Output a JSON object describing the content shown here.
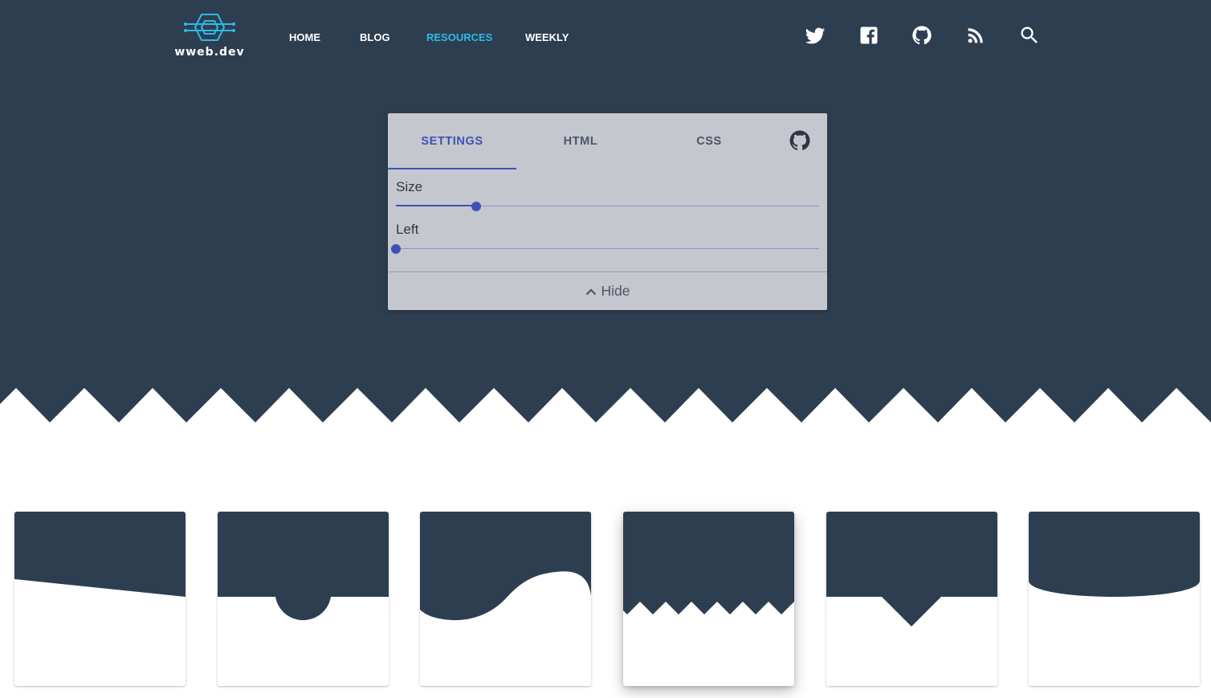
{
  "brand": {
    "name": "wweb.dev",
    "accent": "#2bbbe7",
    "dark": "#2e3e51"
  },
  "nav": [
    {
      "label": "HOME",
      "active": false
    },
    {
      "label": "BLOG",
      "active": false
    },
    {
      "label": "RESOURCES",
      "active": true
    },
    {
      "label": "WEEKLY",
      "active": false
    }
  ],
  "social": [
    "twitter-icon",
    "facebook-icon",
    "github-icon",
    "rss-icon",
    "search-icon"
  ],
  "panel": {
    "tabs": [
      {
        "label": "SETTINGS",
        "active": true
      },
      {
        "label": "HTML",
        "active": false
      },
      {
        "label": "CSS",
        "active": false
      }
    ],
    "repo_icon": "github-icon",
    "sliders": [
      {
        "label": "Size",
        "value": 0.19
      },
      {
        "label": "Left",
        "value": 0
      }
    ],
    "hide_label": "Hide",
    "hide_icon": "chevron-up-icon",
    "accent": "#3f51b5"
  },
  "shapes": [
    {
      "name": "slant",
      "selected": false
    },
    {
      "name": "circle",
      "selected": false
    },
    {
      "name": "wave",
      "selected": false
    },
    {
      "name": "zigzag",
      "selected": true
    },
    {
      "name": "triangle",
      "selected": false
    },
    {
      "name": "curve",
      "selected": false
    }
  ]
}
